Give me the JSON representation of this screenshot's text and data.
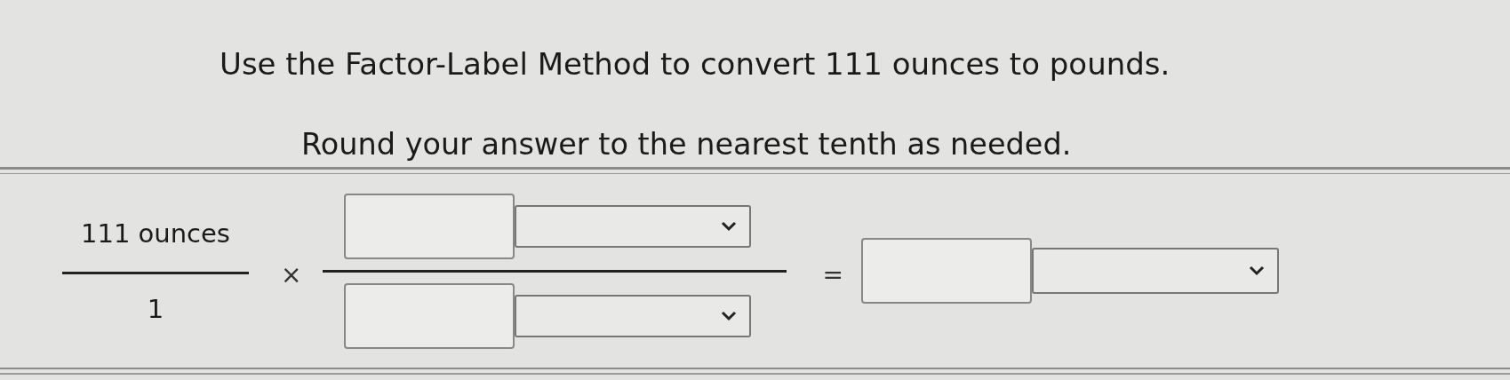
{
  "question": {
    "text": "Use the Factor-Label Method to convert 111 ounces to pounds."
  },
  "instruction": {
    "text": "Round your answer to the nearest tenth as needed."
  },
  "equation": {
    "given": {
      "numerator": "111 ounces",
      "denominator": "1"
    },
    "times_sign": "×",
    "equals_sign": "="
  }
}
